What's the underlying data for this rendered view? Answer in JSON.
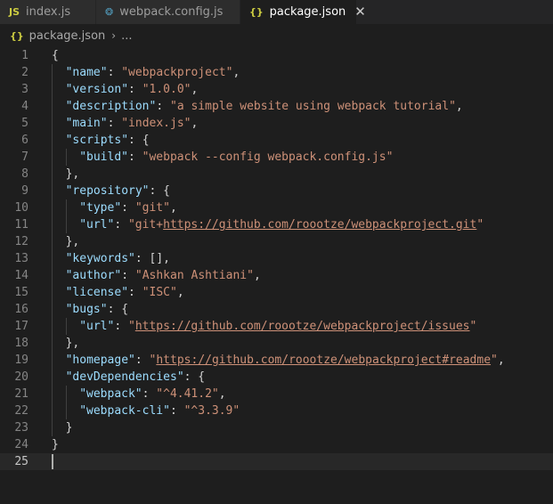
{
  "tabs": [
    {
      "icon": "JS",
      "label": "index.js",
      "active": false
    },
    {
      "icon": "❂",
      "label": "webpack.config.js",
      "active": false
    },
    {
      "icon": "{}",
      "label": "package.json",
      "active": true,
      "close": "✕"
    }
  ],
  "breadcrumb": {
    "icon": "{}",
    "file": "package.json",
    "sep": "›",
    "more": "..."
  },
  "current_line": 25,
  "lines": [
    {
      "n": "1",
      "indent": 0,
      "parts": [
        [
          "p",
          "{"
        ]
      ]
    },
    {
      "n": "2",
      "indent": 1,
      "parts": [
        [
          "k",
          "\"name\""
        ],
        [
          "p",
          ": "
        ],
        [
          "s",
          "\"webpackproject\""
        ],
        [
          "p",
          ","
        ]
      ]
    },
    {
      "n": "3",
      "indent": 1,
      "parts": [
        [
          "k",
          "\"version\""
        ],
        [
          "p",
          ": "
        ],
        [
          "s",
          "\"1.0.0\""
        ],
        [
          "p",
          ","
        ]
      ]
    },
    {
      "n": "4",
      "indent": 1,
      "parts": [
        [
          "k",
          "\"description\""
        ],
        [
          "p",
          ": "
        ],
        [
          "s",
          "\"a simple website using webpack tutorial\""
        ],
        [
          "p",
          ","
        ]
      ]
    },
    {
      "n": "5",
      "indent": 1,
      "parts": [
        [
          "k",
          "\"main\""
        ],
        [
          "p",
          ": "
        ],
        [
          "s",
          "\"index.js\""
        ],
        [
          "p",
          ","
        ]
      ]
    },
    {
      "n": "6",
      "indent": 1,
      "parts": [
        [
          "k",
          "\"scripts\""
        ],
        [
          "p",
          ": {"
        ]
      ]
    },
    {
      "n": "7",
      "indent": 2,
      "parts": [
        [
          "k",
          "\"build\""
        ],
        [
          "p",
          ": "
        ],
        [
          "s",
          "\"webpack --config webpack.config.js\""
        ]
      ]
    },
    {
      "n": "8",
      "indent": 1,
      "parts": [
        [
          "p",
          "},"
        ]
      ]
    },
    {
      "n": "9",
      "indent": 1,
      "parts": [
        [
          "k",
          "\"repository\""
        ],
        [
          "p",
          ": {"
        ]
      ]
    },
    {
      "n": "10",
      "indent": 2,
      "parts": [
        [
          "k",
          "\"type\""
        ],
        [
          "p",
          ": "
        ],
        [
          "s",
          "\"git\""
        ],
        [
          "p",
          ","
        ]
      ]
    },
    {
      "n": "11",
      "indent": 2,
      "parts": [
        [
          "k",
          "\"url\""
        ],
        [
          "p",
          ": "
        ],
        [
          "s",
          "\"git+"
        ],
        [
          "su",
          "https://github.com/roootze/webpackproject.git"
        ],
        [
          "s",
          "\""
        ]
      ]
    },
    {
      "n": "12",
      "indent": 1,
      "parts": [
        [
          "p",
          "},"
        ]
      ]
    },
    {
      "n": "13",
      "indent": 1,
      "parts": [
        [
          "k",
          "\"keywords\""
        ],
        [
          "p",
          ": [],"
        ]
      ]
    },
    {
      "n": "14",
      "indent": 1,
      "parts": [
        [
          "k",
          "\"author\""
        ],
        [
          "p",
          ": "
        ],
        [
          "s",
          "\"Ashkan Ashtiani\""
        ],
        [
          "p",
          ","
        ]
      ]
    },
    {
      "n": "15",
      "indent": 1,
      "parts": [
        [
          "k",
          "\"license\""
        ],
        [
          "p",
          ": "
        ],
        [
          "s",
          "\"ISC\""
        ],
        [
          "p",
          ","
        ]
      ]
    },
    {
      "n": "16",
      "indent": 1,
      "parts": [
        [
          "k",
          "\"bugs\""
        ],
        [
          "p",
          ": {"
        ]
      ]
    },
    {
      "n": "17",
      "indent": 2,
      "parts": [
        [
          "k",
          "\"url\""
        ],
        [
          "p",
          ": "
        ],
        [
          "s",
          "\""
        ],
        [
          "su",
          "https://github.com/roootze/webpackproject/issues"
        ],
        [
          "s",
          "\""
        ]
      ]
    },
    {
      "n": "18",
      "indent": 1,
      "parts": [
        [
          "p",
          "},"
        ]
      ]
    },
    {
      "n": "19",
      "indent": 1,
      "parts": [
        [
          "k",
          "\"homepage\""
        ],
        [
          "p",
          ": "
        ],
        [
          "s",
          "\""
        ],
        [
          "su",
          "https://github.com/roootze/webpackproject#readme"
        ],
        [
          "s",
          "\""
        ],
        [
          "p",
          ","
        ]
      ]
    },
    {
      "n": "20",
      "indent": 1,
      "parts": [
        [
          "k",
          "\"devDependencies\""
        ],
        [
          "p",
          ": {"
        ]
      ]
    },
    {
      "n": "21",
      "indent": 2,
      "parts": [
        [
          "k",
          "\"webpack\""
        ],
        [
          "p",
          ": "
        ],
        [
          "s",
          "\"^4.41.2\""
        ],
        [
          "p",
          ","
        ]
      ]
    },
    {
      "n": "22",
      "indent": 2,
      "parts": [
        [
          "k",
          "\"webpack-cli\""
        ],
        [
          "p",
          ": "
        ],
        [
          "s",
          "\"^3.3.9\""
        ]
      ]
    },
    {
      "n": "23",
      "indent": 1,
      "parts": [
        [
          "p",
          "}"
        ]
      ]
    },
    {
      "n": "24",
      "indent": 0,
      "parts": [
        [
          "p",
          "}"
        ]
      ]
    },
    {
      "n": "25",
      "indent": 0,
      "parts": []
    }
  ]
}
